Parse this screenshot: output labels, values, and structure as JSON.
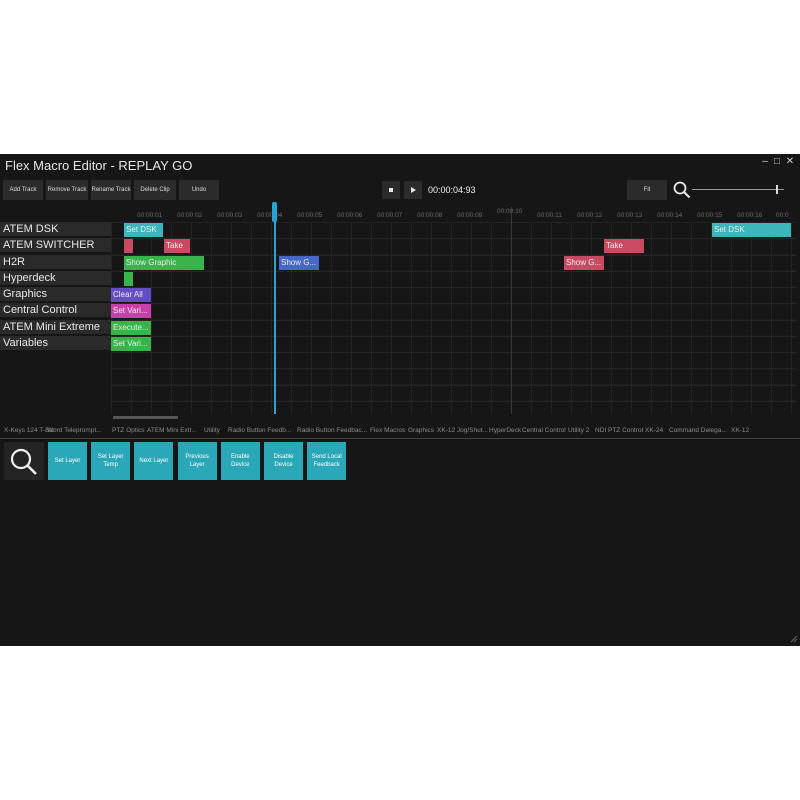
{
  "window": {
    "title": "Flex Macro Editor - REPLAY GO",
    "minimize_glyph": "–",
    "maximize_glyph": "□",
    "close_glyph": "✕"
  },
  "toolbar": {
    "add_track": "Add Track",
    "remove_track": "Remove Track",
    "rename_track": "Rename Track",
    "delete_clip": "Delete Clip",
    "undo": "Undo",
    "timecode": "00:00:04:93",
    "fit": "Fit",
    "zoom_level": 0.9
  },
  "ruler": {
    "ticks": [
      "00:00:01",
      "00:00:02",
      "00:00:03",
      "00:00:04",
      "00:00:05",
      "00:00:06",
      "00:00:07",
      "00:00:08",
      "00:00:09",
      "00:00:10",
      "00:00:11",
      "00:00:12",
      "00:00:13",
      "00:00:14",
      "00:00:15",
      "00:00:16",
      "00:0"
    ]
  },
  "tracks": [
    {
      "name": "ATEM DSK"
    },
    {
      "name": "ATEM SWITCHER"
    },
    {
      "name": "H2R"
    },
    {
      "name": "Hyperdeck"
    },
    {
      "name": "Graphics"
    },
    {
      "name": "Central Control"
    },
    {
      "name": "ATEM Mini Extreme"
    },
    {
      "name": "Variables"
    }
  ],
  "clips": [
    {
      "track": 0,
      "label": "Set DSK",
      "color": "#3fc4c8"
    },
    {
      "track": 0,
      "label": "Set DSK",
      "color": "#3fc4c8"
    },
    {
      "track": 1,
      "label": "",
      "color": "#d9506a"
    },
    {
      "track": 1,
      "label": "Take",
      "color": "#d9506a"
    },
    {
      "track": 1,
      "label": "Take",
      "color": "#d9506a"
    },
    {
      "track": 2,
      "label": "Show Graphic",
      "color": "#3dc24f"
    },
    {
      "track": 2,
      "label": "Show G...",
      "color": "#4a6fd6"
    },
    {
      "track": 2,
      "label": "Show G...",
      "color": "#d9506a"
    },
    {
      "track": 3,
      "label": "",
      "color": "#3dc24f"
    },
    {
      "track": 4,
      "label": "Clear All",
      "color": "#6b53d6"
    },
    {
      "track": 5,
      "label": "Set Vari...",
      "color": "#d944b8"
    },
    {
      "track": 6,
      "label": "Execute...",
      "color": "#3dc24f"
    },
    {
      "track": 7,
      "label": "Set Vari...",
      "color": "#3dc24f"
    }
  ],
  "group_tabs": [
    "X-Keys 124 T-Bar",
    "Word Teleprompt...",
    "PTZ Optics",
    "ATEM Mini Extr...",
    "Utility",
    "Radio Button Feedb...",
    "Radio Button Feedbac...",
    "Flex Macros",
    "Graphics",
    "XK-12 Jog/Shut...",
    "HyperDeck",
    "Central Control",
    "Utility 2",
    "NDI PTZ Control",
    "XK-24",
    "Command Delega...",
    "XK-12"
  ],
  "commands": [
    "Set Layer",
    "Set Layer Temp",
    "Next Layer",
    "Previous Layer",
    "Enable Device",
    "Disable Device",
    "Send Local Feedback"
  ],
  "icons": {
    "search": "search-icon",
    "zoom": "zoom-icon"
  },
  "colors": {
    "playhead": "#29a3d6",
    "command_tile": "#2aa8b8"
  }
}
